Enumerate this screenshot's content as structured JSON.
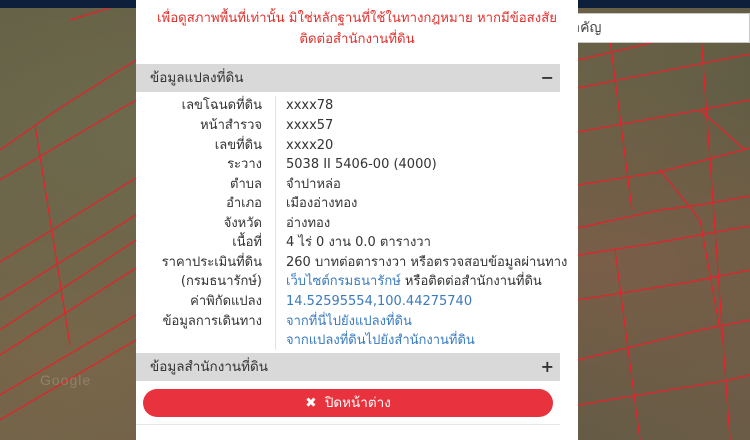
{
  "search": {
    "placeholder": "ค้นหาสถานที่สำคัญ"
  },
  "disclaimer": {
    "line1": "เพื่อดูสภาพพื้นที่เท่านั้น มิใช่หลักฐานที่ใช้ในทางกฎหมาย หากมีข้อสงสัย",
    "line2": "ติดต่อสำนักงานที่ดิน"
  },
  "parcel_section": {
    "title": "ข้อมูลแปลงที่ดิน",
    "toggle": "−",
    "rows": [
      {
        "label": "เลขโฉนดที่ดิน",
        "value": "xxxx78"
      },
      {
        "label": "หน้าสำรวจ",
        "value": "xxxx57"
      },
      {
        "label": "เลขที่ดิน",
        "value": "xxxx20"
      },
      {
        "label": "ระวาง",
        "value": "5038 II 5406-00 (4000)"
      },
      {
        "label": "ตำบล",
        "value": "จำปาหล่อ"
      },
      {
        "label": "อำเภอ",
        "value": "เมืองอ่างทอง"
      },
      {
        "label": "จังหวัด",
        "value": "อ่างทอง"
      },
      {
        "label": "เนื้อที่",
        "value": "4 ไร่ 0 งาน 0.0 ตารางวา"
      }
    ],
    "price": {
      "label1": "ราคาประเมินที่ดิน",
      "label2": "(กรมธนารักษ์)",
      "value1": "260 บาทต่อตารางวา หรือตรวจสอบข้อมูลผ่านทาง",
      "link": "เว็บไซต์กรมธนารักษ์",
      "value2_rest": " หรือติดต่อสำนักงานที่ดิน"
    },
    "coords": {
      "label": "ค่าพิกัดแปลง",
      "value": "14.52595554,100.44275740"
    },
    "travel": {
      "label": "ข้อมูลการเดินทาง",
      "link1": "จากที่นี่ไปยังแปลงที่ดิน",
      "link2": "จากแปลงที่ดินไปยังสำนักงานที่ดิน"
    }
  },
  "office_section": {
    "title": "ข้อมูลสำนักงานที่ดิน",
    "toggle": "+"
  },
  "close_button": {
    "icon": "✖",
    "label": "ปิดหน้าต่าง"
  },
  "map": {
    "watermark": "Google"
  },
  "colors": {
    "accent_red": "#e8333f",
    "link_blue": "#3a7bbf",
    "parcel_line": "#e8202a",
    "top_bar": "#0d1f3a"
  }
}
